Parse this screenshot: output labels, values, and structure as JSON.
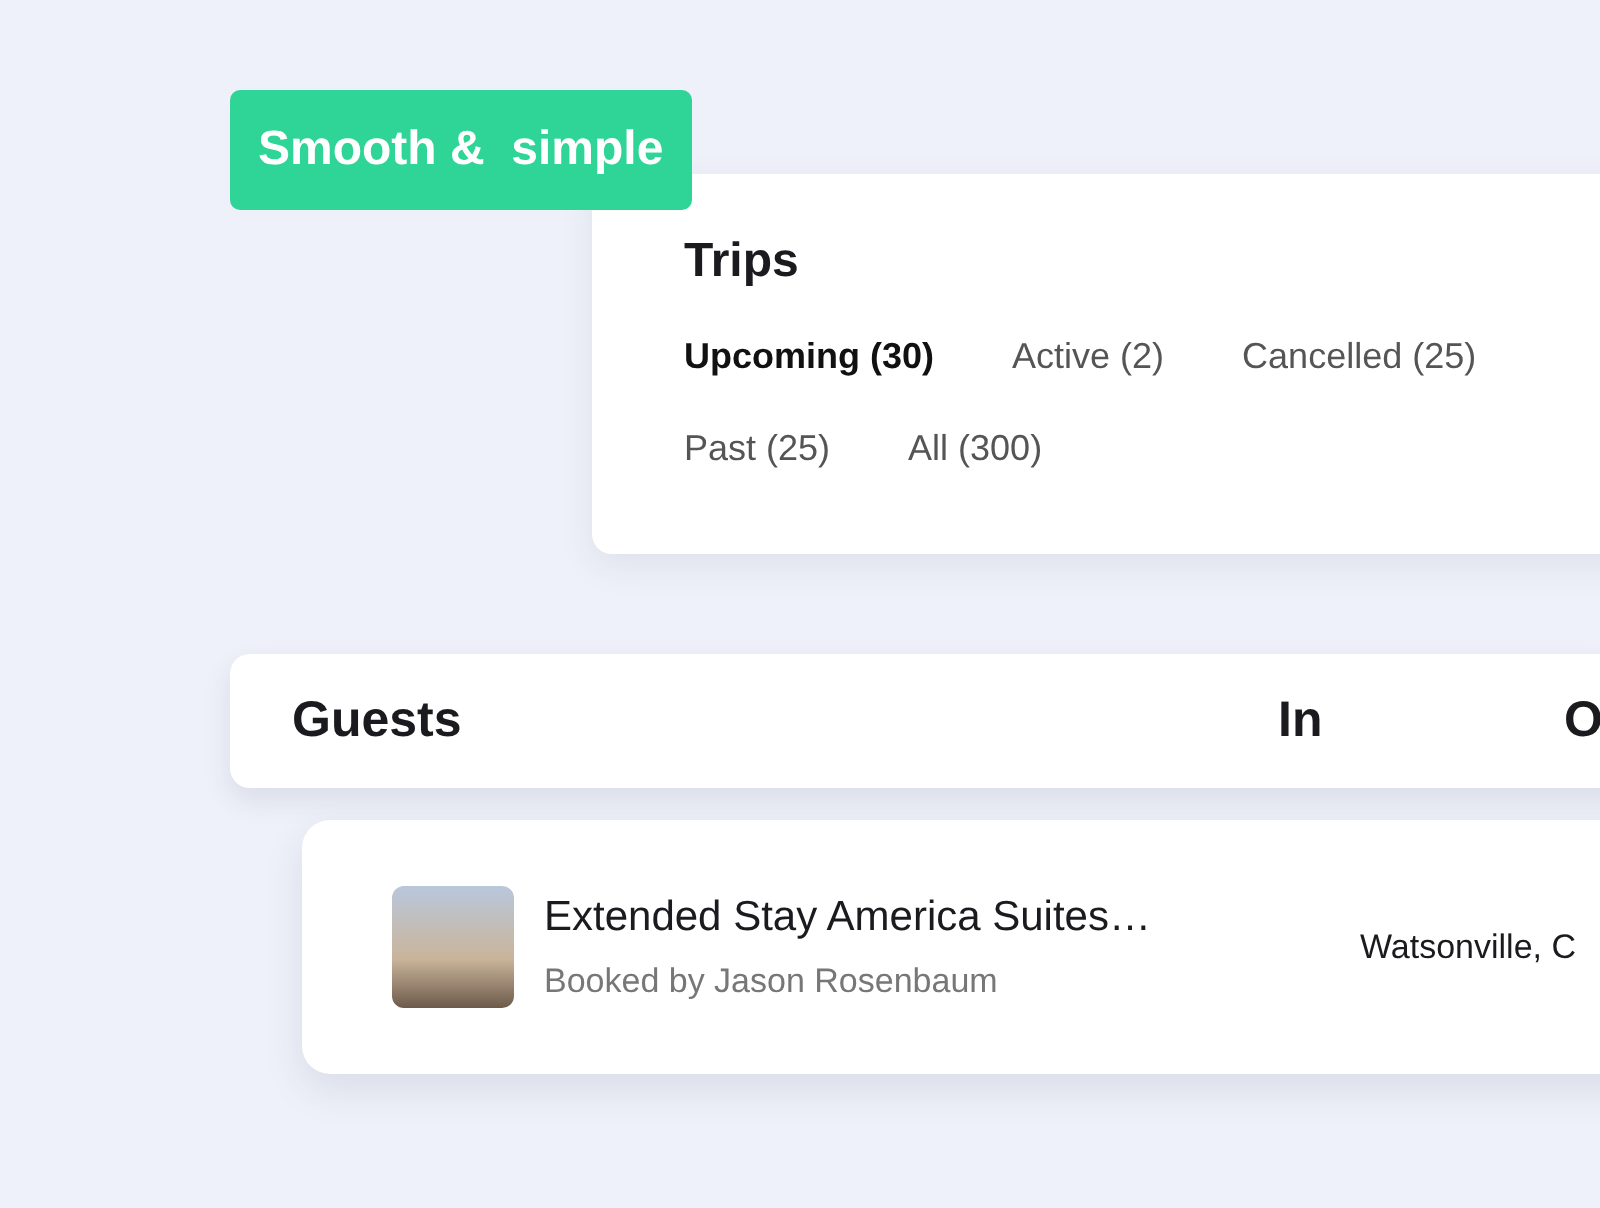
{
  "badge": {
    "label": "Smooth &  simple"
  },
  "trips": {
    "title": "Trips",
    "tabs": [
      {
        "label": "Upcoming (30)",
        "selected": true
      },
      {
        "label": "Active (2)",
        "selected": false
      },
      {
        "label": "Cancelled (25)",
        "selected": false
      },
      {
        "label": "Past (25)",
        "selected": false
      },
      {
        "label": "All (300)",
        "selected": false
      }
    ]
  },
  "table": {
    "columns": [
      "Guests",
      "In",
      "O"
    ],
    "rows": [
      {
        "hotel": "Extended Stay America Suites…",
        "booked_by": "Booked by Jason Rosenbaum",
        "location": "Watsonville, C"
      }
    ]
  }
}
